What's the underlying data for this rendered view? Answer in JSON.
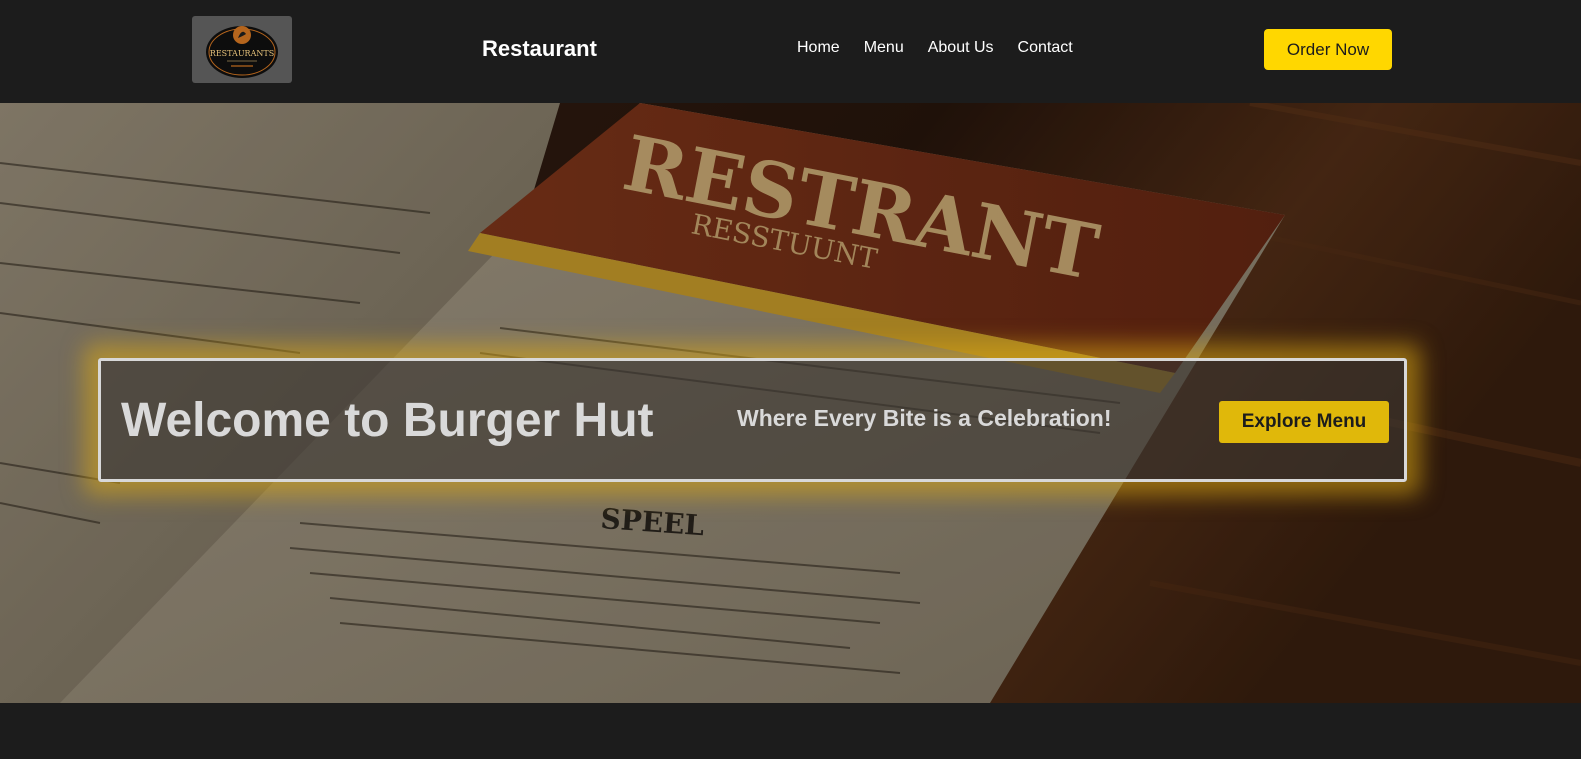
{
  "header": {
    "logo_text": "RESTAURANTS",
    "brand": "Restaurant",
    "nav": [
      {
        "label": "Home"
      },
      {
        "label": "Menu"
      },
      {
        "label": "About Us"
      },
      {
        "label": "Contact"
      }
    ],
    "order_button": "Order Now"
  },
  "hero": {
    "background_image": "restaurant-menu-photo",
    "image_sign_text": "RESTRANT",
    "image_sign_subtext": "RESSTUUNT",
    "image_menu_heading": "SPEEL",
    "title": "Welcome to Burger Hut",
    "tagline": "Where Every Bite is a Celebration!",
    "cta_button": "Explore Menu"
  },
  "colors": {
    "navbar_bg": "#1c1c1c",
    "accent_yellow": "#ffd700",
    "cta_yellow": "#e0b80a",
    "text_light": "#d9d9d9"
  }
}
